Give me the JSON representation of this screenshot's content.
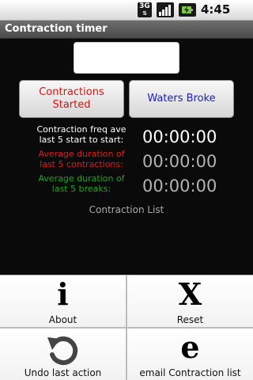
{
  "status_bar": {
    "network": "3G",
    "time": "4:45 PM",
    "icons": [
      "3g-icon",
      "signal-icon",
      "battery-charging-icon"
    ]
  },
  "app": {
    "title": "Contraction timer"
  },
  "input": {
    "value": ""
  },
  "buttons": {
    "contractions_started": "Contractions Started",
    "waters_broke": "Waters Broke"
  },
  "stats": {
    "freq_label": "Contraction freq ave last 5 start to start:",
    "freq_value": "00:00:00",
    "duration_label": "Average duration of last 5 contractions:",
    "duration_value": "00:00:00",
    "breaks_label": "Average duration of last 5 breaks:",
    "breaks_value": "00:00:00"
  },
  "list": {
    "title": "Contraction List"
  },
  "menu": {
    "about": {
      "glyph": "i",
      "label": "About",
      "icon": "info-icon"
    },
    "reset": {
      "glyph": "X",
      "label": "Reset",
      "icon": "x-icon"
    },
    "undo": {
      "label": "Undo last action",
      "icon": "undo-icon"
    },
    "email": {
      "glyph": "e",
      "label": "email Contraction list",
      "icon": "email-icon"
    }
  },
  "colors": {
    "contractions_button_text": "#e01010",
    "waters_button_text": "#1c1ccf",
    "duration_label": "#e01a1a",
    "breaks_label": "#1fa31f"
  }
}
